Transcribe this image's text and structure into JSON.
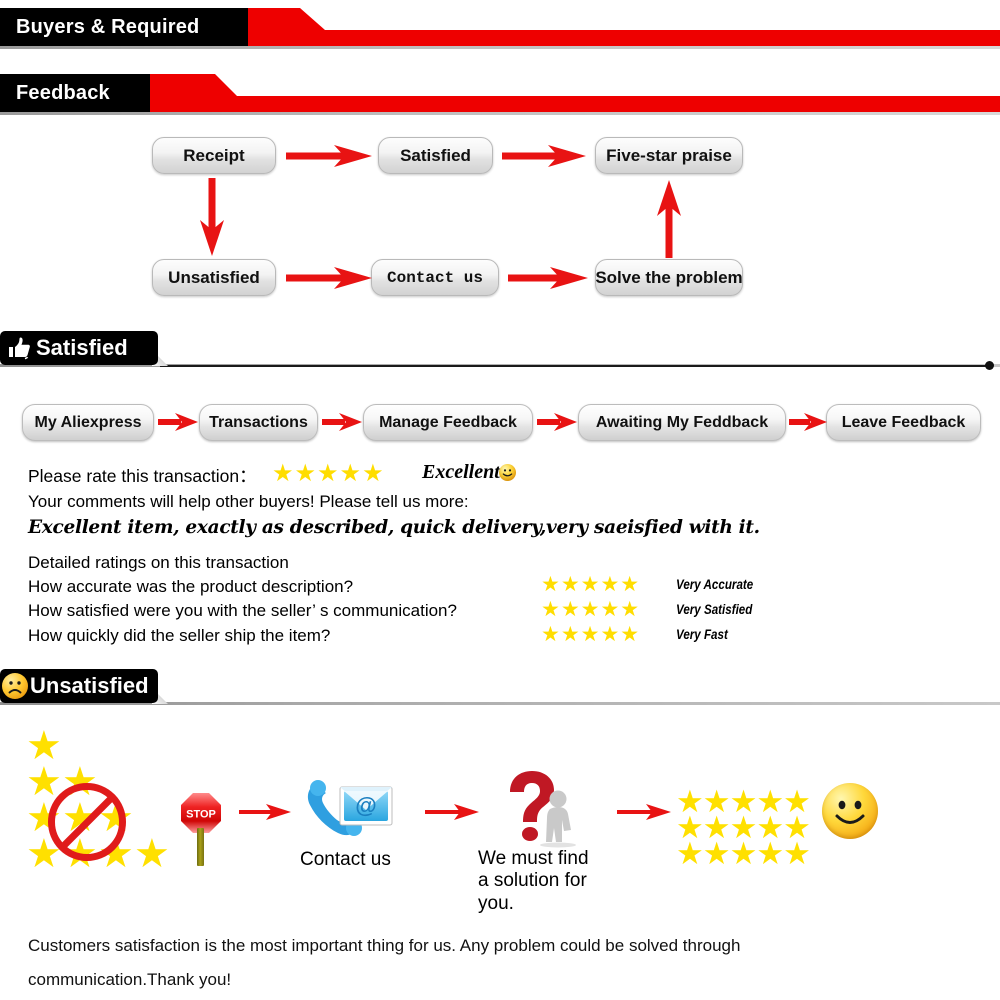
{
  "banners": {
    "buyers": "Buyers & Required",
    "feedback": "Feedback"
  },
  "sections": {
    "satisfied": {
      "label": "Satisfied",
      "icon": "thumbs-up-icon"
    },
    "unsatisfied": {
      "label": "Unsatisfied",
      "icon": "sad-face-icon"
    }
  },
  "flow": {
    "nodes": [
      {
        "id": "receipt",
        "label": "Receipt",
        "mono": false
      },
      {
        "id": "satisfied",
        "label": "Satisfied",
        "mono": false
      },
      {
        "id": "five-star-praise",
        "label": "Five-star praise",
        "mono": false
      },
      {
        "id": "unsatisfied",
        "label": "Unsatisfied",
        "mono": false
      },
      {
        "id": "contact-us",
        "label": "Contact us",
        "mono": true
      },
      {
        "id": "solve-the-problem",
        "label": "Solve the problem",
        "mono": false
      }
    ]
  },
  "navchain": {
    "steps": [
      "My Aliexpress",
      "Transactions",
      "Manage Feedback",
      "Awaiting My Feddback",
      "Leave Feedback"
    ]
  },
  "rating": {
    "prompt": "Please rate this transaction：",
    "stars": "★★★★★",
    "star_count": 5,
    "word": "Excellent",
    "face": "smiley-icon",
    "comments_prompt": "Your comments will help other buyers! Please tell us more:",
    "comment_text": "Excellent item, exactly as described, quick delivery,very saeisfied with it."
  },
  "detailed": {
    "heading": "Detailed ratings on this transaction",
    "rows": [
      {
        "question": "How accurate was the product description?",
        "stars": "★★★★★",
        "stars_count": 5,
        "verdict": "Very Accurate"
      },
      {
        "question": "How satisfied were you with the seller’ s communication?",
        "stars": "★★★★★",
        "stars_count": 5,
        "verdict": "Very Satisfied"
      },
      {
        "question": "How quickly did the seller ship the item?",
        "stars": "★★★★★",
        "stars_count": 5,
        "verdict": "Very Fast"
      }
    ]
  },
  "unsat_flow": {
    "bad_stars_icon": "crossed-out-stars-icon",
    "stop_icon": "stop-sign-icon",
    "stop_label": "STOP",
    "contact_icon": "phone-email-icon",
    "contact_label": "Contact us",
    "solution_icon": "question-mark-person-icon",
    "solution_label": "We must find a solution for you.",
    "good_stars_icon": "fifteen-stars-icon",
    "smiley_icon": "smiley-face-icon"
  },
  "footer": {
    "line1": "Customers satisfaction is the most important thing for us. Any problem could be solved through",
    "line2": "communication.Thank you!"
  },
  "colors": {
    "red": "#ee0000",
    "black": "#000000",
    "star_yellow": "#ffe000",
    "arrow_red": "#e81313"
  }
}
